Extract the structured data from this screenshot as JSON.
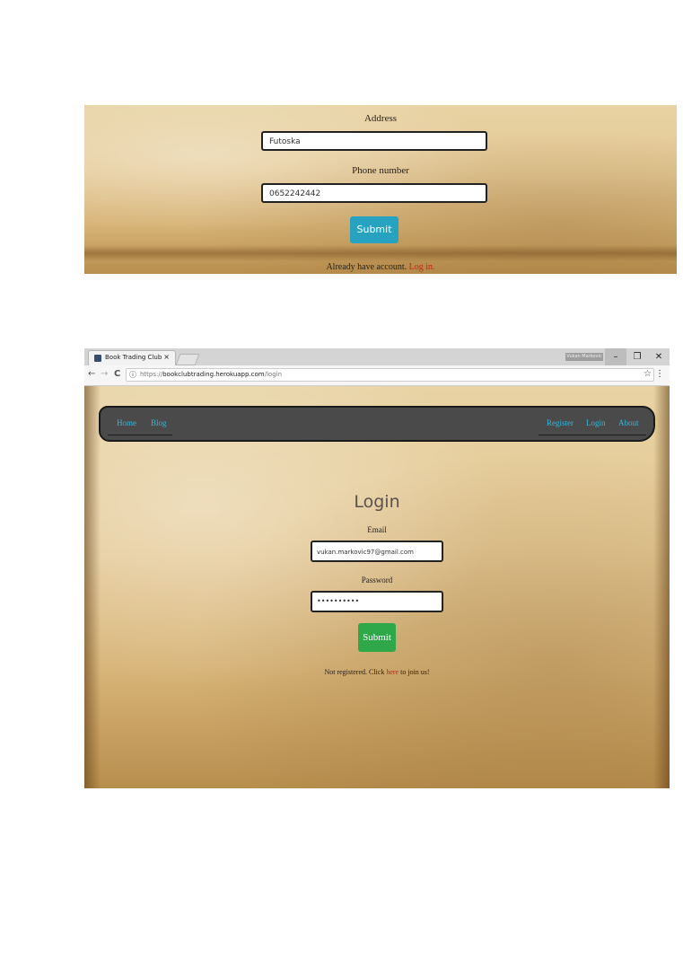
{
  "screenshot1": {
    "address_label": "Address",
    "address_value": "Futoska",
    "phone_label": "Phone number",
    "phone_value": "0652242442",
    "submit_label": "Submit",
    "footer_text": "Already have account.",
    "footer_link": "Log in."
  },
  "screenshot2": {
    "browser": {
      "tab_title": "Book Trading Club",
      "tab_close": "×",
      "user_name": "Vukan Markovic",
      "minimize": "–",
      "restore": "❐",
      "close": "✕",
      "back": "←",
      "forward": "→",
      "reload": "C",
      "info_icon": "ⓘ",
      "url_scheme": "https://",
      "url_host": "bookclubtrading.herokuapp.com",
      "url_path": "/login",
      "star": "☆",
      "menu": "⋮"
    },
    "nav": {
      "home": "Home",
      "blog": "Blog",
      "register": "Register",
      "login": "Login",
      "about": "About"
    },
    "form": {
      "title": "Login",
      "email_label": "Email",
      "email_value": "vukan.markovic97@gmail.com",
      "password_label": "Password",
      "password_value": "••••••••••",
      "submit_label": "Submit",
      "footer_prefix": "Not registered. Click",
      "footer_link": "here",
      "footer_suffix": "to join us!"
    },
    "colors": {
      "nav_link": "#39b6d8",
      "submit_green": "#2fa84a",
      "link_red": "#c0261a"
    }
  }
}
